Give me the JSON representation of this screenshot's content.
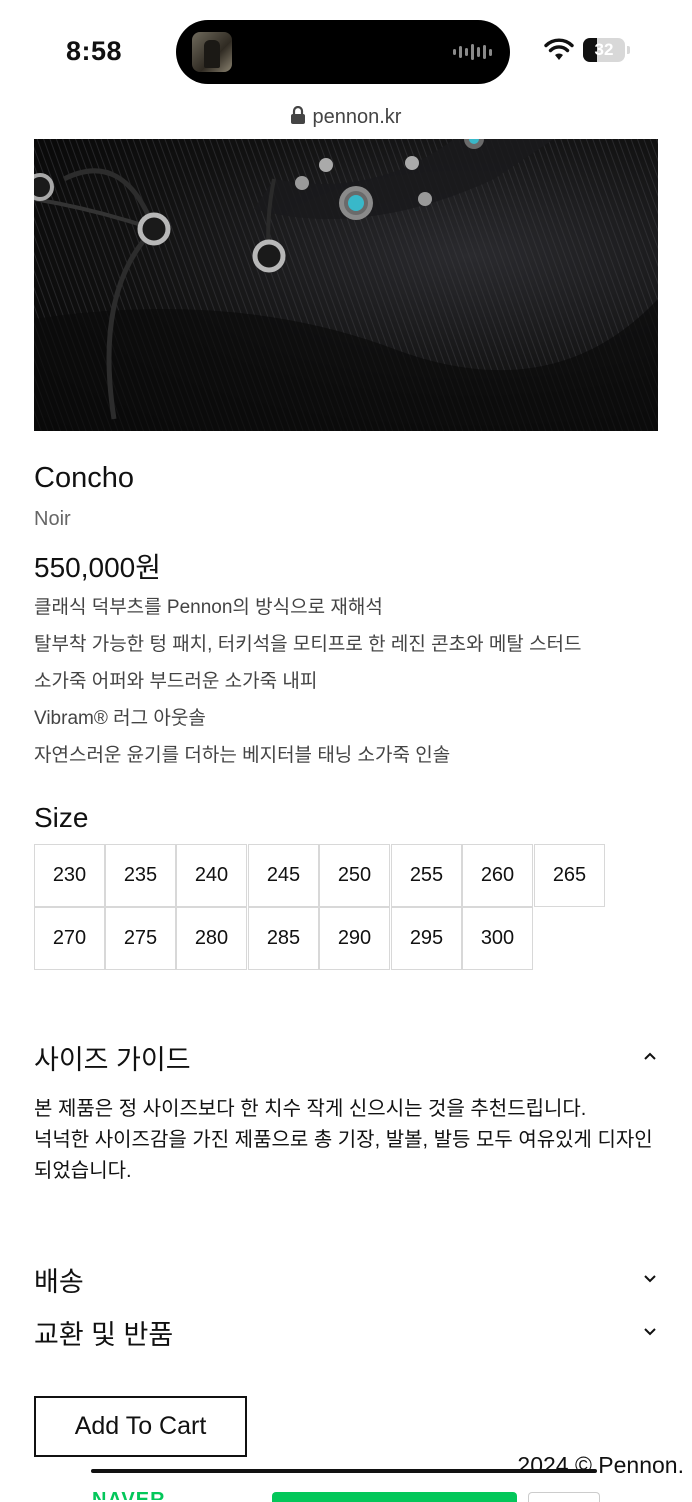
{
  "status_bar": {
    "time": "8:58",
    "battery": "32"
  },
  "browser": {
    "url": "pennon.kr"
  },
  "product": {
    "name": "Concho",
    "color": "Noir",
    "price": "550,000원",
    "features": [
      "클래식 덕부츠를 Pennon의 방식으로 재해석",
      "탈부착 가능한 텅 패치, 터키석을 모티프로 한 레진 콘초와 메탈 스터드",
      "소가죽 어퍼와 부드러운 소가죽 내피",
      "Vibram® 러그 아웃솔",
      "자연스러운 윤기를 더하는 베지터블 태닝 소가죽 인솔"
    ]
  },
  "size_section": {
    "title": "Size",
    "sizes": [
      "230",
      "235",
      "240",
      "245",
      "250",
      "255",
      "260",
      "265",
      "270",
      "275",
      "280",
      "285",
      "290",
      "295",
      "300"
    ]
  },
  "size_guide": {
    "title": "사이즈 가이드",
    "body_line1": "본 제품은 정 사이즈보다 한 치수 작게 신으시는 것을 추천드립니다.",
    "body_line2": "넉넉한 사이즈감을 가진 제품으로 총 기장, 발볼, 발등 모두 여유있게 디자인되었습니다."
  },
  "shipping": {
    "title": "배송"
  },
  "returns": {
    "title": "교환 및 반품"
  },
  "cart": {
    "label": "Add To Cart"
  },
  "footer": {
    "copyright": "2024 © Pennon.",
    "naver_logo": "NAVER"
  }
}
